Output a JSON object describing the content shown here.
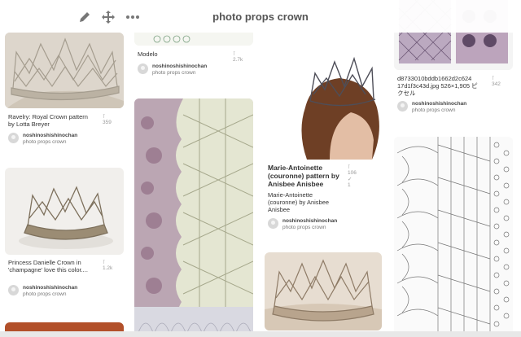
{
  "board": {
    "title": "photo props crown"
  },
  "pins": [
    {
      "desc": "Ravelry: Royal Crown pattern by Lotta Breyer",
      "repins": "359",
      "owner": "noshinoshishinochan",
      "board": "photo props crown"
    },
    {
      "desc": "Princess Danielle Crown in 'champagne' love this color....",
      "repins": "1.2k",
      "owner": "noshinoshishinochan",
      "board": "photo props crown"
    },
    {
      "desc": "Modelo",
      "repins": "2.7k",
      "owner": "noshinoshishinochan",
      "board": "photo props crown"
    },
    {
      "title": "Marie-Antoinette (couronne) pattern by Anisbee Anisbee",
      "desc": "Marie-Antoinette (couronne) by Anisbee Anisbee",
      "repins": "106",
      "likes": "1",
      "owner": "noshinoshishinochan",
      "board": "photo props crown"
    },
    {
      "desc": "d8733010bddb1662d2c624 17d1f3c43d.jpg 526×1,905 ピクセル",
      "repins": "342",
      "owner": "noshinoshishinochan",
      "board": "photo props crown"
    }
  ],
  "colors": {
    "accent": "#cb2027",
    "muted": "#999999"
  },
  "icons": [
    "edit-pencil-icon",
    "move-arrows-icon",
    "more-dots-icon",
    "pin-icon",
    "heart-check-icon"
  ]
}
